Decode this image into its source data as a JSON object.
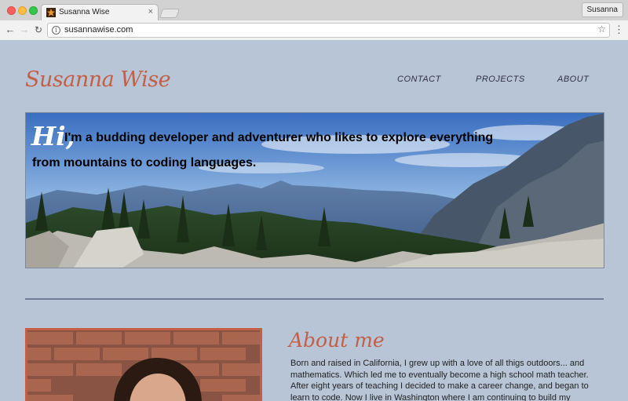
{
  "browser": {
    "tab_title": "Susanna Wise",
    "tab_close": "×",
    "profile_name": "Susanna",
    "url": "susannawise.com",
    "info": "i",
    "back": "←",
    "forward": "→",
    "reload": "↻",
    "bookmark": "☆",
    "menu": "⋮"
  },
  "site": {
    "logo": "Susanna Wise",
    "nav": {
      "contact": "CONTACT",
      "projects": "PROJECTS",
      "about": "ABOUT"
    }
  },
  "hero": {
    "greeting": "Hi,",
    "line1": "I'm a budding developer and adventurer who likes to explore everything",
    "line2": "from mountains to coding languages."
  },
  "about": {
    "heading": "About me",
    "body": "Born and raised in California, I grew up with a love of all thigs outdoors... and mathematics. Which led me to eventually become a high school math teacher. After eight years of teaching I decided to make a career change, and began to learn to code. Now I live in Washington where I am continuing to build my"
  },
  "colors": {
    "page_bg": "#b7c5d6",
    "accent": "#c45f45",
    "divider": "#6e7d95"
  }
}
